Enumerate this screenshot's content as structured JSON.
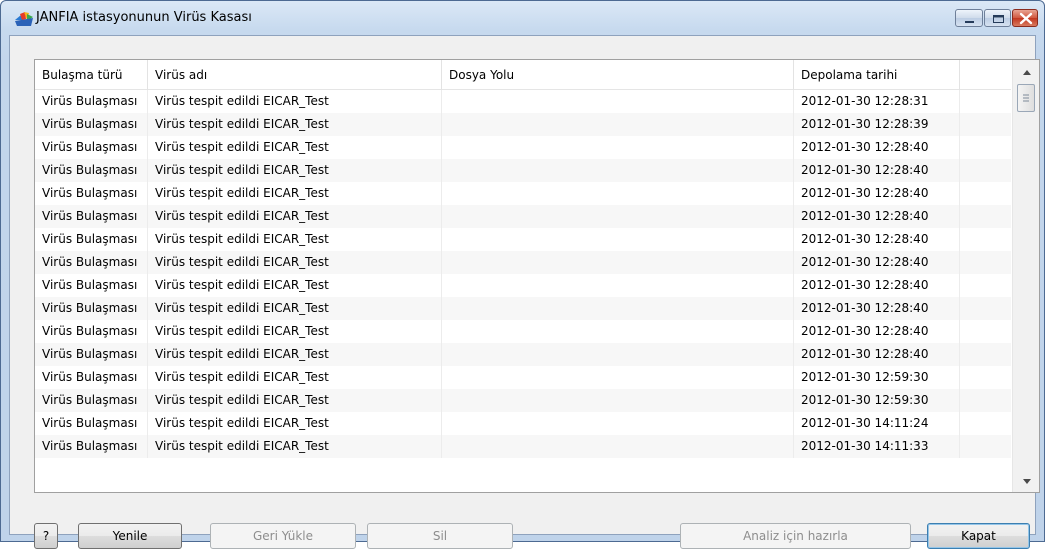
{
  "window": {
    "title": "JANFIA istasyonunun Virüs Kasası"
  },
  "table": {
    "columns": [
      "Bulaşma türü",
      "Virüs adı",
      "Dosya Yolu",
      "Depolama tarihi"
    ],
    "rows": [
      [
        "Virüs Bulaşması",
        "Virüs tespit edildi EICAR_Test",
        "",
        "2012-01-30 12:28:31"
      ],
      [
        "Virüs Bulaşması",
        "Virüs tespit edildi EICAR_Test",
        "",
        "2012-01-30 12:28:39"
      ],
      [
        "Virüs Bulaşması",
        "Virüs tespit edildi EICAR_Test",
        "",
        "2012-01-30 12:28:40"
      ],
      [
        "Virüs Bulaşması",
        "Virüs tespit edildi EICAR_Test",
        "",
        "2012-01-30 12:28:40"
      ],
      [
        "Virüs Bulaşması",
        "Virüs tespit edildi EICAR_Test",
        "",
        "2012-01-30 12:28:40"
      ],
      [
        "Virüs Bulaşması",
        "Virüs tespit edildi EICAR_Test",
        "",
        "2012-01-30 12:28:40"
      ],
      [
        "Virüs Bulaşması",
        "Virüs tespit edildi EICAR_Test",
        "",
        "2012-01-30 12:28:40"
      ],
      [
        "Virüs Bulaşması",
        "Virüs tespit edildi EICAR_Test",
        "",
        "2012-01-30 12:28:40"
      ],
      [
        "Virüs Bulaşması",
        "Virüs tespit edildi EICAR_Test",
        "",
        "2012-01-30 12:28:40"
      ],
      [
        "Virüs Bulaşması",
        "Virüs tespit edildi EICAR_Test",
        "",
        "2012-01-30 12:28:40"
      ],
      [
        "Virüs Bulaşması",
        "Virüs tespit edildi EICAR_Test",
        "",
        "2012-01-30 12:28:40"
      ],
      [
        "Virüs Bulaşması",
        "Virüs tespit edildi EICAR_Test",
        "",
        "2012-01-30 12:28:40"
      ],
      [
        "Virüs Bulaşması",
        "Virüs tespit edildi EICAR_Test",
        "",
        "2012-01-30 12:59:30"
      ],
      [
        "Virüs Bulaşması",
        "Virüs tespit edildi EICAR_Test",
        "",
        "2012-01-30 12:59:30"
      ],
      [
        "Virüs Bulaşması",
        "Virüs tespit edildi EICAR_Test",
        "",
        "2012-01-30 14:11:24"
      ],
      [
        "Virüs Bulaşması",
        "Virüs tespit edildi EICAR_Test",
        "",
        "2012-01-30 14:11:33"
      ]
    ]
  },
  "buttons": {
    "help": "?",
    "refresh": "Yenile",
    "restore": "Geri Yükle",
    "delete": "Sil",
    "prepare_analysis": "Analiz için hazırla",
    "close": "Kapat"
  },
  "icons": {
    "app": "avg-logo-icon",
    "minimize": "minimize-icon",
    "maximize": "maximize-icon",
    "close": "close-icon"
  }
}
